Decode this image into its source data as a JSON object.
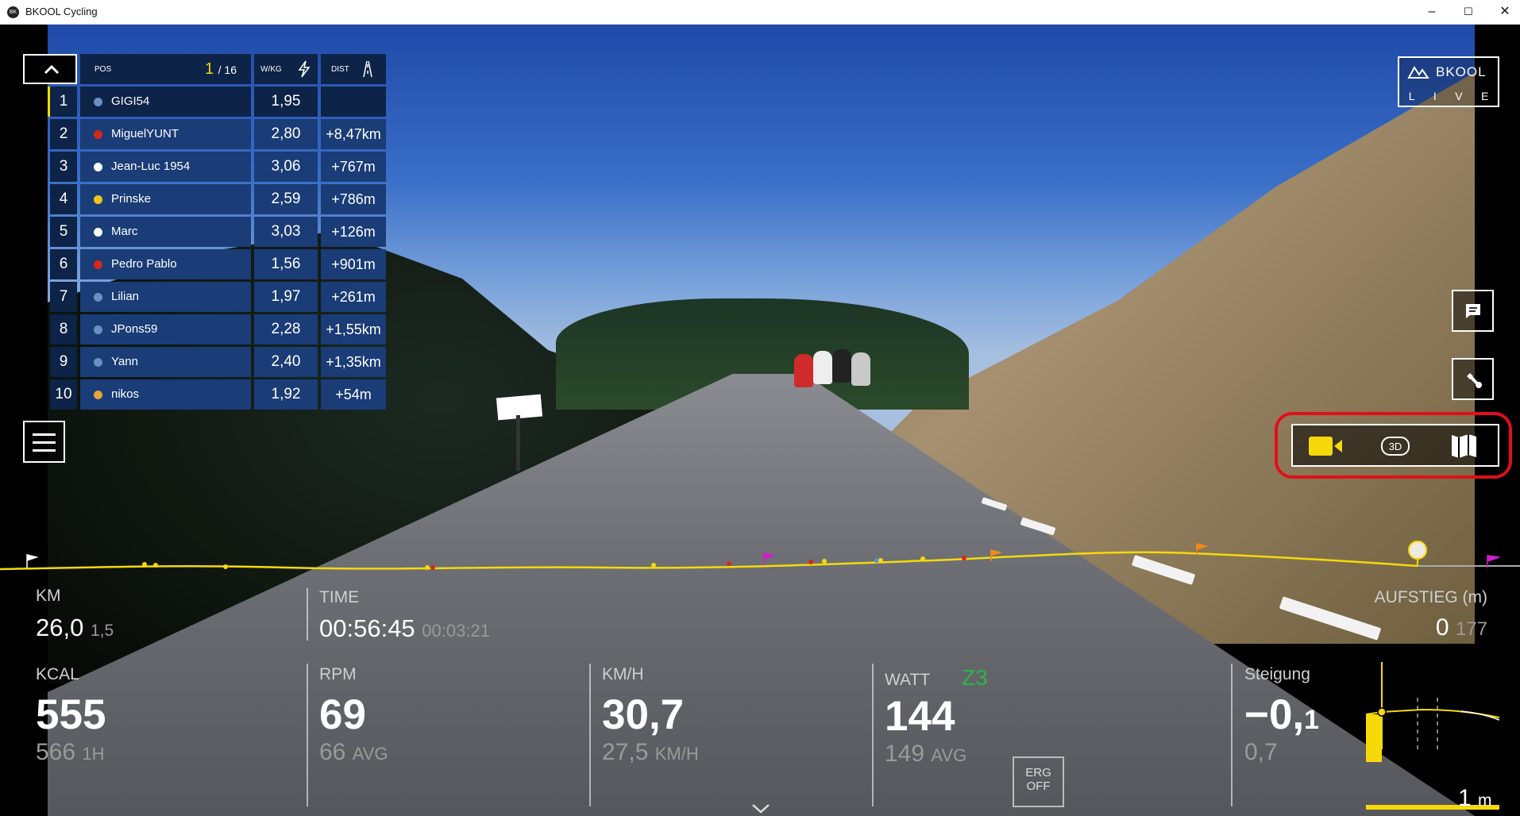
{
  "window": {
    "title": "BKOOL Cycling",
    "app_icon": "BK",
    "controls": {
      "minimize": "–",
      "maximize": "☐",
      "close": "✕"
    }
  },
  "leaderboard": {
    "pos_label": "POS",
    "pos_value": "1",
    "pos_total": "/ 16",
    "wkg_label": "W/KG",
    "dist_label": "DIST",
    "rows": [
      {
        "rank": "1",
        "name": "GIGI54",
        "wkg": "1,95",
        "dist": "",
        "flag": "#6a8fc2"
      },
      {
        "rank": "2",
        "name": "MiguelYUNT",
        "wkg": "2,80",
        "dist": "+8,47km",
        "flag": "#d9261c"
      },
      {
        "rank": "3",
        "name": "Jean-Luc 1954",
        "wkg": "3,06",
        "dist": "+767m",
        "flag": "#ffffff"
      },
      {
        "rank": "4",
        "name": "Prinske",
        "wkg": "2,59",
        "dist": "+786m",
        "flag": "#f0c419"
      },
      {
        "rank": "5",
        "name": "Marc",
        "wkg": "3,03",
        "dist": "+126m",
        "flag": "#ffffff"
      },
      {
        "rank": "6",
        "name": "Pedro Pablo",
        "wkg": "1,56",
        "dist": "+901m",
        "flag": "#d9261c"
      },
      {
        "rank": "7",
        "name": "Lilian",
        "wkg": "1,97",
        "dist": "+261m",
        "flag": "#6a8fc2"
      },
      {
        "rank": "8",
        "name": "JPons59",
        "wkg": "2,28",
        "dist": "+1,55km",
        "flag": "#6a8fc2"
      },
      {
        "rank": "9",
        "name": "Yann",
        "wkg": "2,40",
        "dist": "+1,35km",
        "flag": "#6a8fc2"
      },
      {
        "rank": "10",
        "name": "nikos",
        "wkg": "1,92",
        "dist": "+54m",
        "flag": "#e8a33a"
      }
    ]
  },
  "logo": {
    "brand": "BKOOL",
    "live": [
      "L",
      "I",
      "V",
      "E"
    ]
  },
  "stats": {
    "km": {
      "label": "KM",
      "value": "26,0",
      "sub": "1,5"
    },
    "time": {
      "label": "TIME",
      "value": "00:56:45",
      "sub": "00:03:21"
    },
    "aufstieg": {
      "label": "AUFSTIEG (m)",
      "value": "0",
      "sub": "177"
    },
    "kcal": {
      "label": "KCAL",
      "value": "555",
      "sub": "566",
      "sub_unit": "1H"
    },
    "rpm": {
      "label": "RPM",
      "value": "69",
      "sub": "66",
      "sub_unit": "AVG"
    },
    "kmh": {
      "label": "KM/H",
      "value": "30,7",
      "sub": "27,5",
      "sub_unit": "KM/H"
    },
    "watt": {
      "label": "WATT",
      "zone": "Z3",
      "value": "144",
      "sub": "149",
      "sub_unit": "AVG"
    },
    "erg": {
      "line1": "ERG",
      "line2": "OFF"
    },
    "steigung": {
      "label": "Steigung",
      "value": "−0,",
      "value_dec": "1",
      "sub": "0,7"
    },
    "minimap": {
      "value": "1",
      "unit": "m"
    }
  },
  "colors": {
    "accent": "#f5d90a",
    "panel_dark": "#0d2347",
    "panel": "#1a3c77",
    "zone": "#2db34a",
    "highlight": "#e10f1a"
  },
  "icons": {
    "collapse": "chevron-up-icon",
    "chat": "chat-icon",
    "tools": "wrench-icon",
    "camera": "video-camera-icon",
    "view3d": "3d-view-icon",
    "map": "map-icon",
    "menu": "hamburger-menu-icon",
    "expand": "chevron-down-icon"
  }
}
